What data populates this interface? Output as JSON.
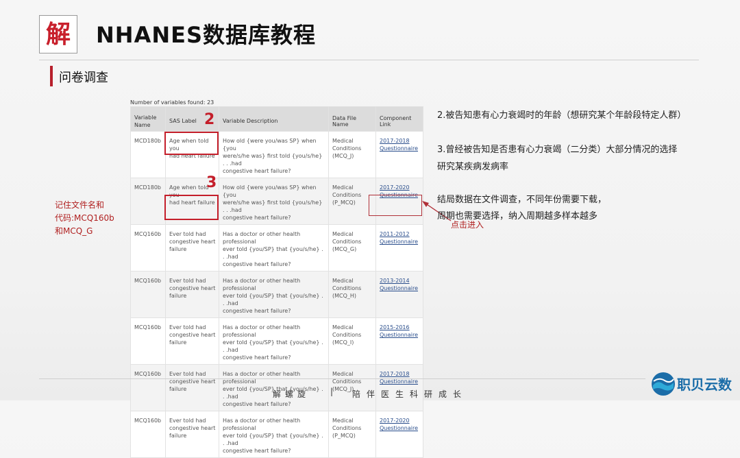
{
  "header": {
    "logo_char": "解",
    "title": "NHANES数据库教程",
    "section_title": "问卷调查"
  },
  "table": {
    "count_text": "Number of variables found: 23",
    "columns": [
      "Variable Name",
      "SAS Label",
      "Variable Description",
      "Data File Name",
      "Component Link"
    ],
    "rows": [
      {
        "name": "MCD180b",
        "label": [
          "Age when told you",
          "had heart failure"
        ],
        "desc": [
          "How old {were you/was SP} when {you",
          "were/s/he was} first told {you/s/he} . . .had",
          "congestive heart failure?"
        ],
        "file": [
          "Medical",
          "Conditions",
          "(MCQ_J)"
        ],
        "link": [
          "2017-2018",
          "Questionnaire"
        ]
      },
      {
        "name": "MCD180b",
        "label": [
          "Age when told you",
          "had heart failure"
        ],
        "desc": [
          "How old {were you/was SP} when {you",
          "were/s/he was} first told {you/s/he} . . .had",
          "congestive heart failure?"
        ],
        "file": [
          "Medical",
          "Conditions",
          "(P_MCQ)"
        ],
        "link": [
          "2017-2020",
          "Questionnaire"
        ]
      },
      {
        "name": "MCQ160b",
        "label": [
          "Ever told had",
          "congestive heart",
          "failure"
        ],
        "desc": [
          "Has a doctor or other health professional",
          "ever told {you/SP} that {you/s/he} . . .had",
          "congestive heart failure?"
        ],
        "file": [
          "Medical",
          "Conditions",
          "(MCQ_G)"
        ],
        "link": [
          "2011-2012",
          "Questionnaire"
        ]
      },
      {
        "name": "MCQ160b",
        "label": [
          "Ever told had",
          "congestive heart",
          "failure"
        ],
        "desc": [
          "Has a doctor or other health professional",
          "ever told {you/SP} that {you/s/he} . . .had",
          "congestive heart failure?"
        ],
        "file": [
          "Medical",
          "Conditions",
          "(MCQ_H)"
        ],
        "link": [
          "2013-2014",
          "Questionnaire"
        ]
      },
      {
        "name": "MCQ160b",
        "label": [
          "Ever told had",
          "congestive heart",
          "failure"
        ],
        "desc": [
          "Has a doctor or other health professional",
          "ever told {you/SP} that {you/s/he} . . .had",
          "congestive heart failure?"
        ],
        "file": [
          "Medical",
          "Conditions",
          "(MCQ_I)"
        ],
        "link": [
          "2015-2016",
          "Questionnaire"
        ]
      },
      {
        "name": "MCQ160b",
        "label": [
          "Ever told had",
          "congestive heart",
          "failure"
        ],
        "desc": [
          "Has a doctor or other health professional",
          "ever told {you/SP} that {you/s/he} . . .had",
          "congestive heart failure?"
        ],
        "file": [
          "Medical",
          "Conditions",
          "(MCQ_J)"
        ],
        "link": [
          "2017-2018",
          "Questionnaire"
        ]
      },
      {
        "name": "MCQ160b",
        "label": [
          "Ever told had",
          "congestive heart",
          "failure"
        ],
        "desc": [
          "Has a doctor or other health professional",
          "ever told {you/SP} that {you/s/he} . . .had",
          "congestive heart failure?"
        ],
        "file": [
          "Medical",
          "Conditions",
          "(P_MCQ)"
        ],
        "link": [
          "2017-2020",
          "Questionnaire"
        ]
      }
    ]
  },
  "annotations": {
    "num2": "2",
    "num3": "3",
    "left_note": [
      "记住文件名和",
      "代码:MCQ160b",
      "和MCQ_G"
    ],
    "note2": "2.被告知患有心力衰竭时的年龄（想研究某个年龄段特定人群）",
    "note3_line1": "3.曾经被告知是否患有心力衰竭（二分类）大部分情况的选择",
    "note3_line2": "研究某疾病发病率",
    "note4_line1": "结局数据在文件调查，不同年份需要下载，",
    "note4_line2": "周期也需要选择，纳入周期越多样本越多",
    "click_note": "点击进入",
    "accent_color": "#c41e2a"
  },
  "footer": {
    "left": "解螺旋",
    "separator": "|",
    "right": "陪伴医生科研成长",
    "brand": "职贝云数"
  }
}
